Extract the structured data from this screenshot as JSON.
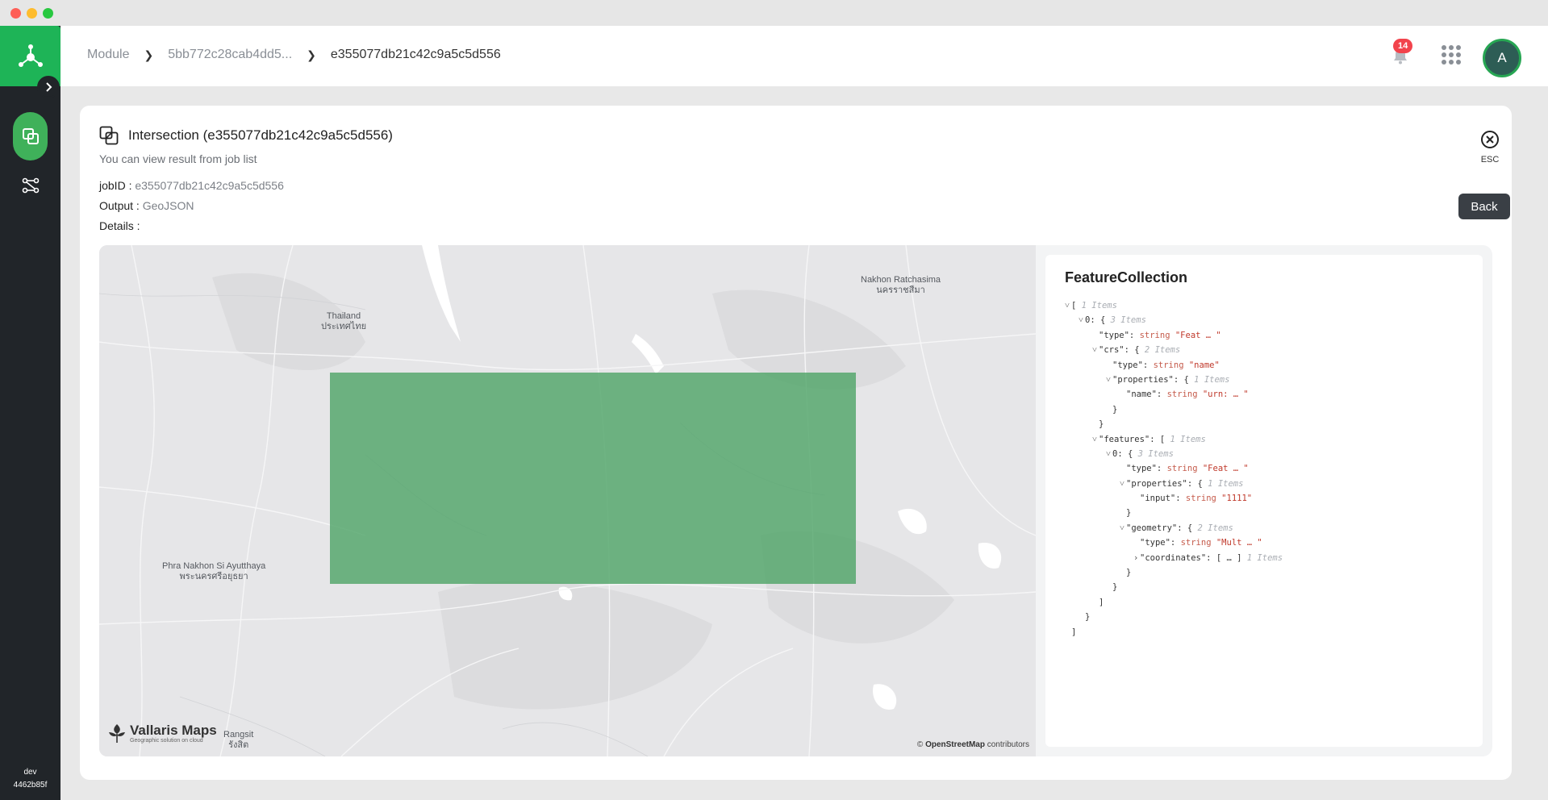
{
  "window": {
    "traffic_lights": [
      "close",
      "minimize",
      "zoom"
    ]
  },
  "sidebar": {
    "items": [
      {
        "icon": "layers-icon",
        "active": true
      },
      {
        "icon": "workflow-icon",
        "active": false
      }
    ],
    "footer_env": "dev",
    "footer_build": "4462b85f"
  },
  "header": {
    "breadcrumb": [
      "Module",
      "5bb772c28cab4dd5...",
      "e355077db21c42c9a5c5d556"
    ],
    "notification_count": "14",
    "avatar_initial": "A"
  },
  "card": {
    "title": "Intersection (e355077db21c42c9a5c5d556)",
    "subtitle": "You can view result from job list",
    "esc_label": "ESC",
    "job_id_label": "jobID :",
    "job_id_value": "e355077db21c42c9a5c5d556",
    "output_label": "Output :",
    "output_value": "GeoJSON",
    "details_label": "Details :",
    "back_label": "Back"
  },
  "map": {
    "labels": {
      "thailand_en": "Thailand",
      "thailand_th": "ประเทศไทย",
      "nakhon_en": "Nakhon Ratchasima",
      "nakhon_th": "นครราชสีมา",
      "ayutthaya_en": "Phra Nakhon Si Ayutthaya",
      "ayutthaya_th": "พระนครศรีอยุธยา",
      "rangsit_en": "Rangsit",
      "rangsit_th": "รังสิต"
    },
    "brand_name": "Vallaris Maps",
    "brand_tagline": "Geographic solution on cloud",
    "attribution_prefix": "©",
    "attribution_link": "OpenStreetMap",
    "attribution_suffix": "contributors",
    "result_fill_color": "#50a569"
  },
  "json_view": {
    "title": "FeatureCollection",
    "lines": [
      {
        "indent": 0,
        "caret": "v",
        "key": "",
        "open": "[",
        "count": "1 Items"
      },
      {
        "indent": 1,
        "caret": "v",
        "key": "0:",
        "open": "{",
        "count": "3 Items"
      },
      {
        "indent": 2,
        "caret": "",
        "key": "\"type\":",
        "type": "string",
        "value": "\"Feat … \""
      },
      {
        "indent": 2,
        "caret": "v",
        "key": "\"crs\":",
        "open": "{",
        "count": "2 Items"
      },
      {
        "indent": 3,
        "caret": "",
        "key": "\"type\":",
        "type": "string",
        "value": "\"name\""
      },
      {
        "indent": 3,
        "caret": "v",
        "key": "\"properties\":",
        "open": "{",
        "count": "1 Items"
      },
      {
        "indent": 4,
        "caret": "",
        "key": "\"name\":",
        "type": "string",
        "value": "\"urn: … \""
      },
      {
        "indent": 3,
        "caret": "",
        "close": "}"
      },
      {
        "indent": 2,
        "caret": "",
        "close": "}"
      },
      {
        "indent": 2,
        "caret": "v",
        "key": "\"features\":",
        "open": "[",
        "count": "1 Items"
      },
      {
        "indent": 3,
        "caret": "v",
        "key": "0:",
        "open": "{",
        "count": "3 Items"
      },
      {
        "indent": 4,
        "caret": "",
        "key": "\"type\":",
        "type": "string",
        "value": "\"Feat … \""
      },
      {
        "indent": 4,
        "caret": "v",
        "key": "\"properties\":",
        "open": "{",
        "count": "1 Items"
      },
      {
        "indent": 5,
        "caret": "",
        "key": "\"input\":",
        "type": "string",
        "value": "\"1111\""
      },
      {
        "indent": 4,
        "caret": "",
        "close": "}"
      },
      {
        "indent": 4,
        "caret": "v",
        "key": "\"geometry\":",
        "open": "{",
        "count": "2 Items"
      },
      {
        "indent": 5,
        "caret": "",
        "key": "\"type\":",
        "type": "string",
        "value": "\"Mult … \""
      },
      {
        "indent": 5,
        "caret": ">",
        "key": "\"coordinates\":",
        "open": "[ … ]",
        "count": "1 Items"
      },
      {
        "indent": 4,
        "caret": "",
        "close": "}"
      },
      {
        "indent": 3,
        "caret": "",
        "close": "}"
      },
      {
        "indent": 2,
        "caret": "",
        "close": "]"
      },
      {
        "indent": 1,
        "caret": "",
        "close": "}"
      },
      {
        "indent": 0,
        "caret": "",
        "close": "]"
      }
    ]
  }
}
